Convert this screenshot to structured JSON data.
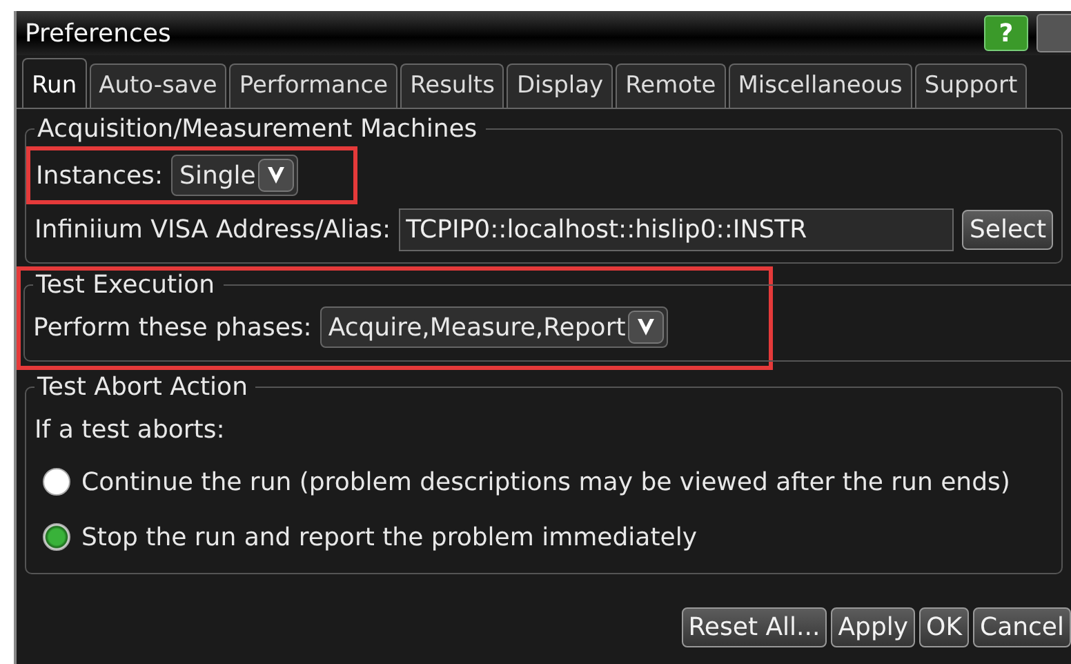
{
  "window": {
    "title": "Preferences",
    "help": "?"
  },
  "tabs": [
    {
      "label": "Run",
      "selected": true
    },
    {
      "label": "Auto-save",
      "selected": false
    },
    {
      "label": "Performance",
      "selected": false
    },
    {
      "label": "Results",
      "selected": false
    },
    {
      "label": "Display",
      "selected": false
    },
    {
      "label": "Remote",
      "selected": false
    },
    {
      "label": "Miscellaneous",
      "selected": false
    },
    {
      "label": "Support",
      "selected": false
    }
  ],
  "machines": {
    "title": "Acquisition/Measurement Machines",
    "instances_label": "Instances:",
    "instances_value": "Single",
    "instances_highlighted": true,
    "visa_label": "Infiniium VISA Address/Alias:",
    "visa_value": "TCPIP0::localhost::hislip0::INSTR",
    "select_button": "Select"
  },
  "execution": {
    "title": "Test Execution",
    "highlighted": true,
    "phases_label": "Perform these phases:",
    "phases_value": "Acquire,Measure,Report"
  },
  "abort": {
    "title": "Test Abort Action",
    "prompt": "If a test aborts:",
    "options": [
      {
        "label": "Continue the run (problem descriptions may be viewed after the run ends)",
        "selected": false
      },
      {
        "label": "Stop the run and report the problem immediately",
        "selected": true
      }
    ]
  },
  "buttons": [
    "Reset All...",
    "Apply",
    "OK",
    "Cancel"
  ]
}
